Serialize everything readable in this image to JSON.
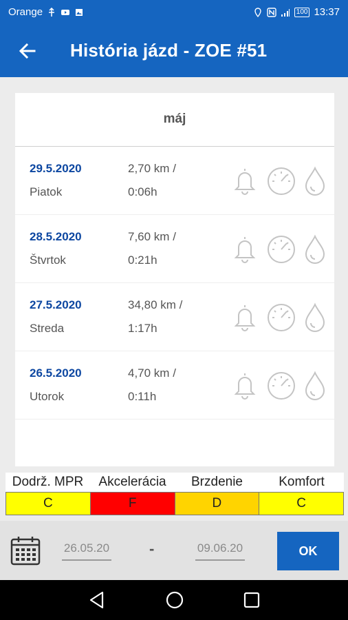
{
  "status": {
    "carrier": "Orange",
    "battery": "100",
    "time": "13:37"
  },
  "appbar": {
    "title": "História jázd - ZOE #51"
  },
  "month": "máj",
  "trips": [
    {
      "date": "29.5.2020",
      "day": "Piatok",
      "distance": "2,70 km /",
      "duration": "0:06h"
    },
    {
      "date": "28.5.2020",
      "day": "Štvrtok",
      "distance": "7,60 km /",
      "duration": "0:21h"
    },
    {
      "date": "27.5.2020",
      "day": "Streda",
      "distance": "34,80 km /",
      "duration": "1:17h"
    },
    {
      "date": "26.5.2020",
      "day": "Utorok",
      "distance": "4,70 km /",
      "duration": "0:11h"
    }
  ],
  "ratings": [
    {
      "label": "Dodrž. MPR",
      "grade": "C",
      "color": "#ffff00"
    },
    {
      "label": "Akcelerácia",
      "grade": "F",
      "color": "#ff0000"
    },
    {
      "label": "Brzdenie",
      "grade": "D",
      "color": "#ffd400"
    },
    {
      "label": "Komfort",
      "grade": "C",
      "color": "#ffff00"
    }
  ],
  "filter": {
    "from": "26.05.20",
    "separator": "-",
    "to": "09.06.20",
    "ok_label": "OK"
  },
  "icons": {
    "trip_alert": "bell-icon",
    "trip_speed": "speedometer-icon",
    "trip_fluid": "drop-icon",
    "calendar": "calendar-icon"
  }
}
